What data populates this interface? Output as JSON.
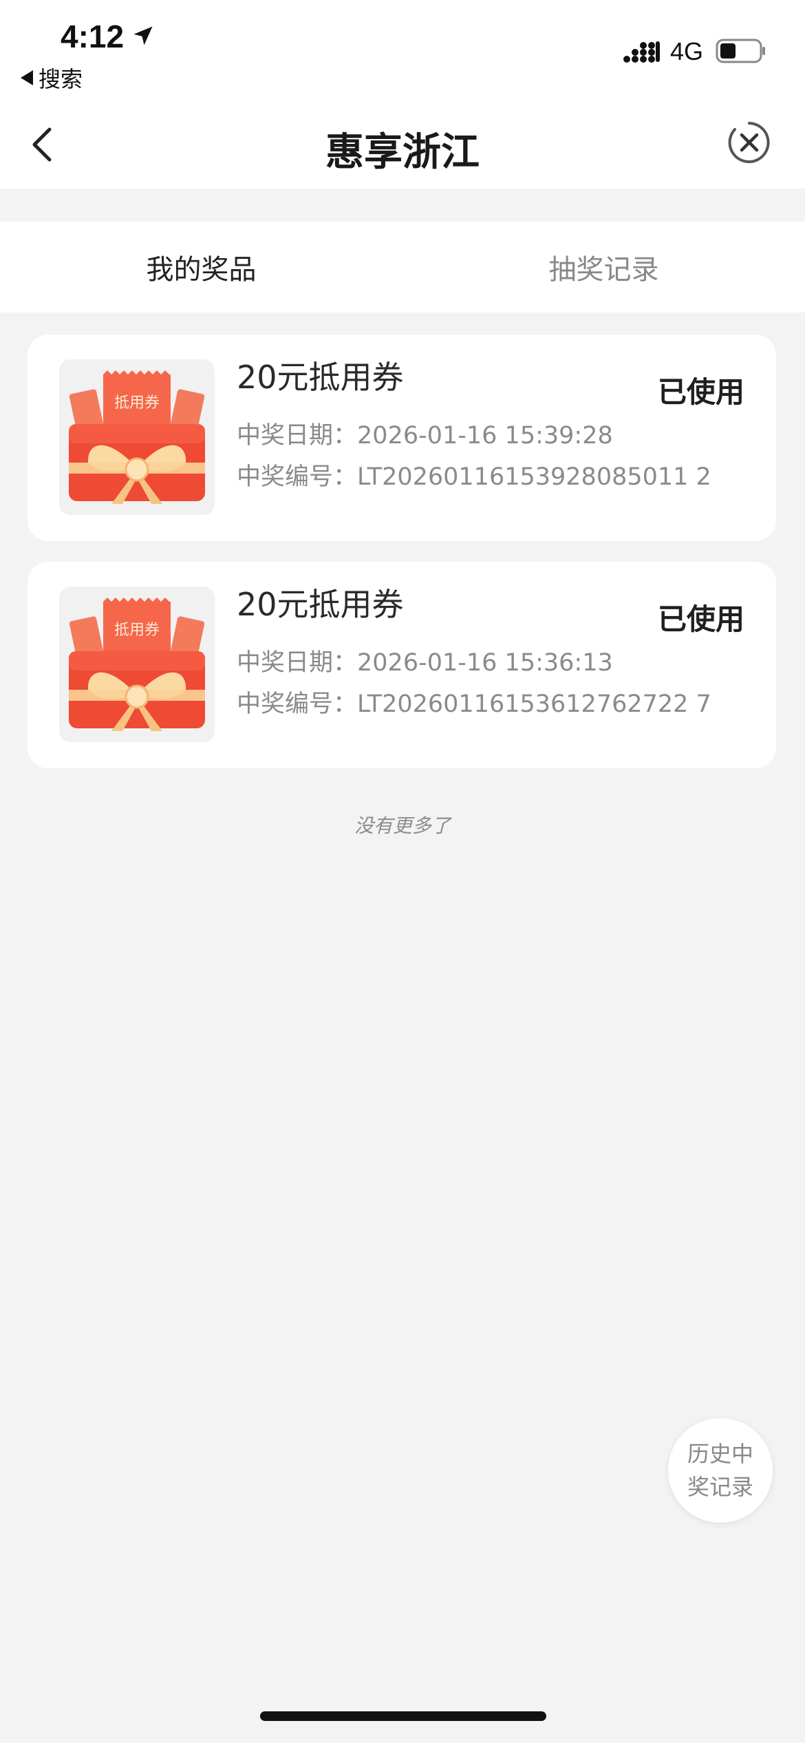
{
  "status_bar": {
    "time": "4:12",
    "back_app_label": "搜索",
    "network": "4G"
  },
  "nav": {
    "title": "惠享浙江"
  },
  "tabs": [
    {
      "label": "我的奖品",
      "active": true
    },
    {
      "label": "抽奖记录",
      "active": false
    }
  ],
  "prizes": [
    {
      "title": "20元抵用券",
      "status": "已使用",
      "ticket_text": "抵用券",
      "date_label": "中奖日期：",
      "date_value": "2026-01-16 15:39:28",
      "code_label": "中奖编号：",
      "code_value": "LT20260116153928085011 2"
    },
    {
      "title": "20元抵用券",
      "status": "已使用",
      "ticket_text": "抵用券",
      "date_label": "中奖日期：",
      "date_value": "2026-01-16 15:36:13",
      "code_label": "中奖编号：",
      "code_value": "LT20260116153612762722 7"
    }
  ],
  "list_end_text": "没有更多了",
  "history_button": {
    "label": "历史中奖记录"
  },
  "colors": {
    "background": "#f3f3f3",
    "card": "#ffffff",
    "accent_red": "#f2553a",
    "ribbon": "#f9c98a"
  }
}
